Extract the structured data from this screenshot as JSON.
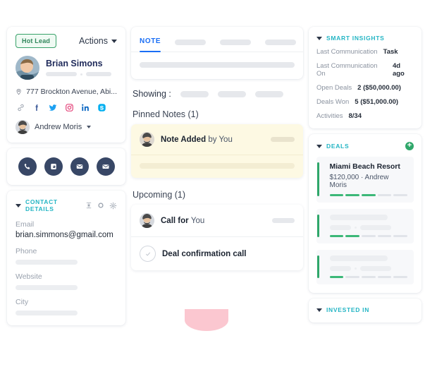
{
  "left_panel": {
    "badge": "Hot Lead",
    "actions_label": "Actions",
    "contact_name": "Brian Simons",
    "address": "777 Brockton Avenue, Abi...",
    "social_icons": [
      "link-icon",
      "facebook-icon",
      "twitter-icon",
      "instagram-icon",
      "linkedin-icon",
      "skype-icon"
    ],
    "owner_name": "Andrew Moris",
    "quick_actions": [
      "phone-icon",
      "call-headset-icon",
      "email-icon",
      "mail-icon"
    ],
    "contact_details": {
      "section_title": "CONTACT DETAILS",
      "header_icons": [
        "collapse-icon",
        "dot-icon",
        "gear-icon"
      ],
      "fields": [
        {
          "label": "Email",
          "value": "brian.simmons@gmail.com"
        },
        {
          "label": "Phone",
          "value": ""
        },
        {
          "label": "Website",
          "value": ""
        },
        {
          "label": "City",
          "value": ""
        }
      ]
    }
  },
  "middle_panel": {
    "tabs": [
      {
        "label": "NOTE",
        "active": true
      },
      {
        "label": "",
        "active": false
      },
      {
        "label": "",
        "active": false
      },
      {
        "label": "",
        "active": false
      }
    ],
    "showing_label": "Showing :",
    "pinned_title": "Pinned Notes (1)",
    "pinned_note": {
      "title_bold": "Note Added",
      "title_light": "by You"
    },
    "upcoming_title": "Upcoming (1)",
    "upcoming_items": [
      {
        "title_bold": "Call for",
        "title_light": "You",
        "type": "avatar"
      },
      {
        "title_bold": "Deal confirmation call",
        "title_light": "",
        "type": "check"
      }
    ]
  },
  "right_panel": {
    "smart_insights": {
      "section_title": "SMART INSIGHTS",
      "rows": [
        {
          "label": "Last Communication",
          "value": "Task"
        },
        {
          "label": "Last Communication On",
          "value": "4d ago"
        },
        {
          "label": "Open Deals",
          "value": "2 ($50,000.00)"
        },
        {
          "label": "Deals Won",
          "value": "5 ($51,000.00)"
        },
        {
          "label": "Activities",
          "value": "8/34"
        }
      ]
    },
    "deals": {
      "section_title": "DEALS",
      "add_label": "+",
      "items": [
        {
          "name": "Miami Beach Resort",
          "meta": "$120,000  ·  Andrew Moris",
          "segments_filled": 3,
          "segments_total": 5
        },
        {
          "name": "",
          "meta": "",
          "segments_filled": 2,
          "segments_total": 5
        },
        {
          "name": "",
          "meta": "",
          "segments_filled": 1,
          "segments_total": 5
        }
      ]
    },
    "invested_in": {
      "section_title": "INVESTED IN"
    }
  },
  "colors": {
    "accent_blue": "#1a6ef5",
    "accent_teal": "#23b5c4",
    "accent_green": "#2fa76a",
    "badge_green": "#38a169",
    "navy": "#384766",
    "pinned_yellow": "#fdf9e3",
    "pink_blob": "#fbc7d0"
  }
}
